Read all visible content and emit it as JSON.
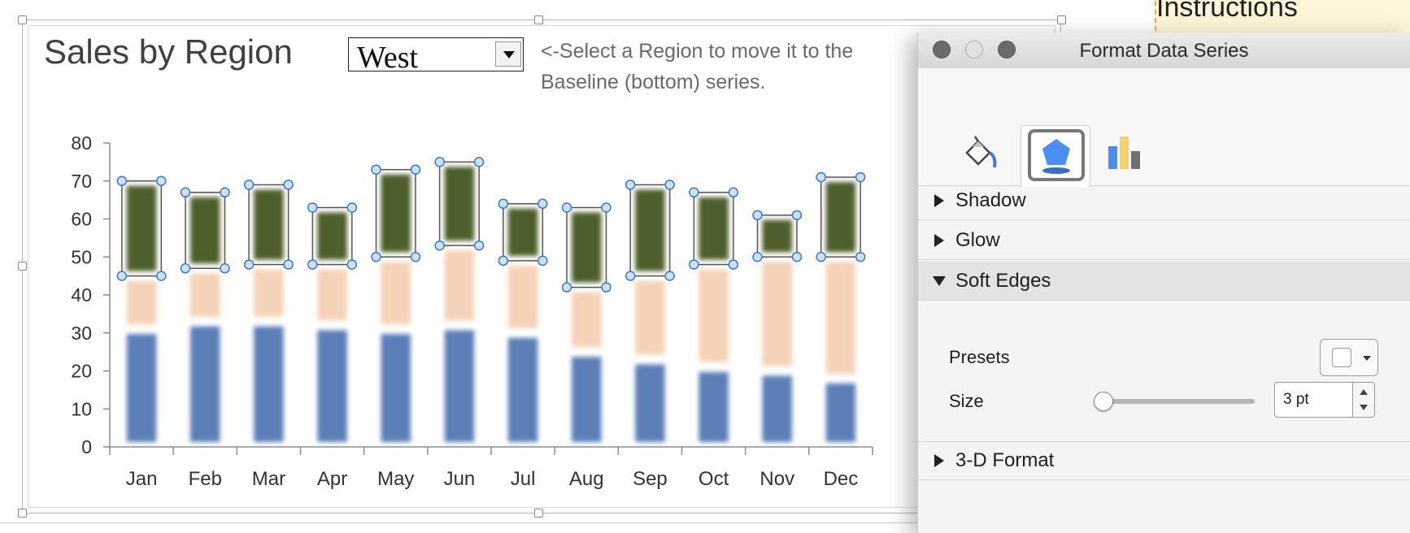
{
  "background": {
    "note_text": "Instructions"
  },
  "chart": {
    "title": "Sales by Region",
    "region_dropdown": {
      "selected": "West"
    },
    "hint_text": "<-Select a Region to move it to the Baseline (bottom) series."
  },
  "chart_data": {
    "type": "bar",
    "stacked": true,
    "categories": [
      "Jan",
      "Feb",
      "Mar",
      "Apr",
      "May",
      "Jun",
      "Jul",
      "Aug",
      "Sep",
      "Oct",
      "Nov",
      "Dec"
    ],
    "series": [
      {
        "values": [
          31,
          33,
          33,
          32,
          31,
          32,
          30,
          25,
          23,
          21,
          20,
          18
        ],
        "color": "#5b7fb8"
      },
      {
        "values": [
          14,
          14,
          15,
          16,
          19,
          21,
          19,
          17,
          22,
          27,
          30,
          32
        ],
        "color": "#f5d3b8"
      },
      {
        "values": [
          25,
          20,
          21,
          15,
          23,
          22,
          15,
          21,
          24,
          19,
          11,
          21
        ],
        "color": "#4e5e2a"
      }
    ],
    "ylim": [
      0,
      80
    ],
    "yticks": [
      "0",
      "10",
      "20",
      "30",
      "40",
      "50",
      "60",
      "70",
      "80"
    ],
    "grid": false,
    "soft_edges": true,
    "selected_series_index": 2
  },
  "format_pane": {
    "title": "Format Data Series",
    "window_buttons": {
      "close": "close-button",
      "minimize": "minimize-button",
      "zoom": "zoom-button"
    },
    "tabs": [
      {
        "name": "fill-line",
        "icon": "paint-bucket-icon"
      },
      {
        "name": "effects",
        "icon": "pentagon-icon",
        "active": true
      },
      {
        "name": "series-options",
        "icon": "bar-chart-icon"
      }
    ],
    "sections": {
      "shadow": "Shadow",
      "glow": "Glow",
      "soft_edges": "Soft Edges",
      "three_d_format": "3-D Format"
    },
    "soft_edges": {
      "presets_label": "Presets",
      "size_label": "Size",
      "size_value": "3 pt",
      "size_slider_fraction": 0.03
    }
  }
}
